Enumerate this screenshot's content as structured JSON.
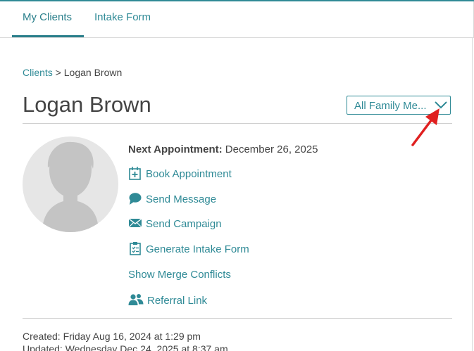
{
  "tabs": {
    "my_clients": "My Clients",
    "intake_form": "Intake Form"
  },
  "breadcrumb": {
    "clients_link": "Clients",
    "separator": " > ",
    "current": "Logan Brown"
  },
  "client": {
    "name": "Logan Brown"
  },
  "family_select": {
    "selected": "All Family Me..."
  },
  "next_appointment": {
    "label": "Next Appointment:",
    "value": " December 26, 2025"
  },
  "actions": {
    "book_appointment": "Book Appointment",
    "send_message": "Send Message",
    "send_campaign": "Send Campaign",
    "generate_intake_form": "Generate Intake Form",
    "show_merge_conflicts": "Show Merge Conflicts",
    "referral_link": "Referral Link"
  },
  "meta": {
    "created": "Created: Friday Aug 16, 2024 at 1:29 pm",
    "updated": "Updated: Wednesday Dec 24, 2025 at 8:37 am"
  },
  "colors": {
    "accent": "#2f8a96",
    "arrow": "#e02020",
    "avatar_bg": "#e6e6e6",
    "avatar_fg": "#c4c4c4"
  }
}
